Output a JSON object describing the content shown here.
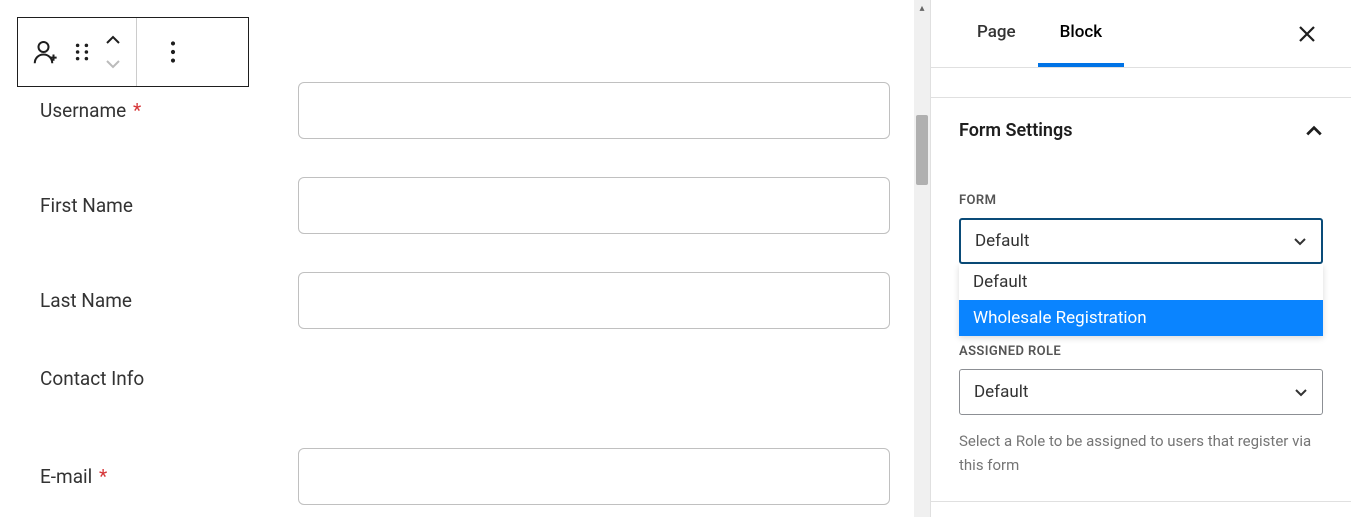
{
  "form": {
    "fields": [
      {
        "label": "Username",
        "required": true,
        "type": "text"
      },
      {
        "label": "First Name",
        "required": false,
        "type": "text"
      },
      {
        "label": "Last Name",
        "required": false,
        "type": "text"
      }
    ],
    "section_heading": "Contact Info",
    "email": {
      "label": "E-mail",
      "required": true
    }
  },
  "sidebar": {
    "tabs": {
      "page": "Page",
      "block": "Block"
    },
    "panel_title": "Form Settings",
    "form_section": {
      "label": "FORM",
      "selected": "Default",
      "options": [
        "Default",
        "Wholesale Registration"
      ]
    },
    "role_section": {
      "label": "ASSIGNED ROLE",
      "selected": "Default",
      "help": "Select a Role to be assigned to users that register via this form"
    }
  }
}
